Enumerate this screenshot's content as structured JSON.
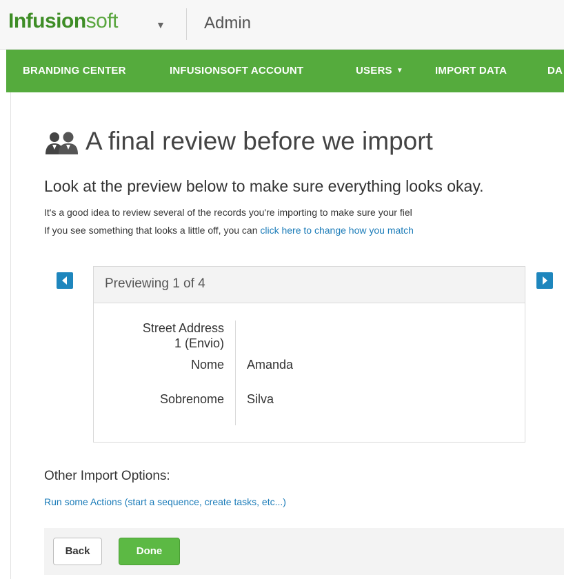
{
  "topbar": {
    "logo_bold": "Infusion",
    "logo_light": "soft",
    "section_title": "Admin"
  },
  "nav": {
    "items": [
      {
        "label": "BRANDING CENTER"
      },
      {
        "label": "INFUSIONSOFT ACCOUNT"
      },
      {
        "label": "USERS"
      },
      {
        "label": "IMPORT DATA"
      },
      {
        "label": "DA"
      }
    ]
  },
  "page": {
    "title": "A final review before we import",
    "subtitle": "Look at the preview below to make sure everything looks okay.",
    "para1": "It's a good idea to review several of the records you're importing to make sure your fiel",
    "para2_prefix": "If you see something that looks a little off, you can ",
    "para2_link": "click here to change how you match"
  },
  "preview": {
    "label": "Previewing 1 of 4",
    "fields": [
      {
        "label_line1": "Street Address",
        "label_line2": "1 (Envio)",
        "value": ""
      },
      {
        "label": "Nome",
        "value": "Amanda"
      },
      {
        "label": "Sobrenome",
        "value": "Silva"
      }
    ]
  },
  "other_options": {
    "title": "Other Import Options:",
    "actions_link": "Run some Actions (start a sequence, create tasks, etc...)"
  },
  "buttons": {
    "back": "Back",
    "done": "Done"
  },
  "colors": {
    "brand_green": "#55ab3d",
    "link_blue": "#1a7bb8",
    "arrow_blue": "#1e86bd",
    "done_green": "#5cb944"
  },
  "icons": {
    "users": "users-icon",
    "nav_caret": "caret-down-icon",
    "logo_caret": "caret-down-icon",
    "prev_arrow": "arrow-left-icon",
    "next_arrow": "arrow-right-icon"
  }
}
